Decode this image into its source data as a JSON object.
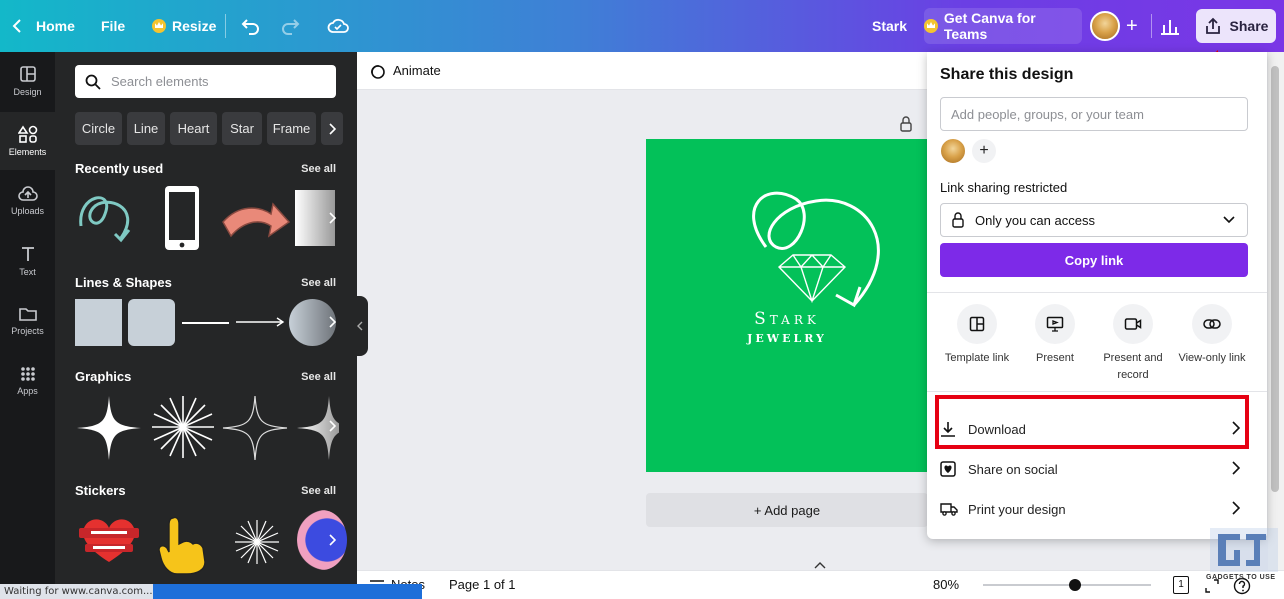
{
  "topbar": {
    "home": "Home",
    "file": "File",
    "resize": "Resize",
    "title": "Stark",
    "teams": "Get Canva for Teams",
    "share": "Share"
  },
  "rail": [
    {
      "label": "Design",
      "icon": "design-icon"
    },
    {
      "label": "Elements",
      "icon": "elements-icon"
    },
    {
      "label": "Uploads",
      "icon": "uploads-icon"
    },
    {
      "label": "Text",
      "icon": "text-icon"
    },
    {
      "label": "Projects",
      "icon": "folder-icon"
    },
    {
      "label": "Apps",
      "icon": "apps-icon"
    }
  ],
  "panel": {
    "search_placeholder": "Search elements",
    "chips": [
      "Circle",
      "Line",
      "Heart",
      "Star",
      "Frame"
    ],
    "sections": {
      "recent": "Recently used",
      "lines": "Lines & Shapes",
      "graphics": "Graphics",
      "stickers": "Stickers"
    },
    "see_all": "See all"
  },
  "canvas": {
    "animate": "Animate",
    "design_title": "Stark",
    "design_subtitle": "JEWELRY",
    "add_page": "+ Add page"
  },
  "share_panel": {
    "title": "Share this design",
    "people_placeholder": "Add people, groups, or your team",
    "link_sharing": "Link sharing restricted",
    "access": "Only you can access",
    "copy_link": "Copy link",
    "options": [
      {
        "label": "Template link",
        "icon": "template-icon"
      },
      {
        "label": "Present",
        "icon": "present-icon"
      },
      {
        "label": "Present and record",
        "icon": "camera-icon"
      },
      {
        "label": "View-only link",
        "icon": "link-icon"
      }
    ],
    "download": "Download",
    "share_social": "Share on social",
    "print": "Print your design"
  },
  "bottom": {
    "notes": "Notes",
    "page": "Page 1 of 1",
    "zoom": "80%",
    "zoom_level": 0.55,
    "page_count": "1"
  },
  "status": "Waiting for www.canva.com...",
  "watermark": "GADGETS TO USE",
  "colors": {
    "accent": "#7d2ae8",
    "design_bg": "#03c159",
    "highlight": "#e60012"
  }
}
